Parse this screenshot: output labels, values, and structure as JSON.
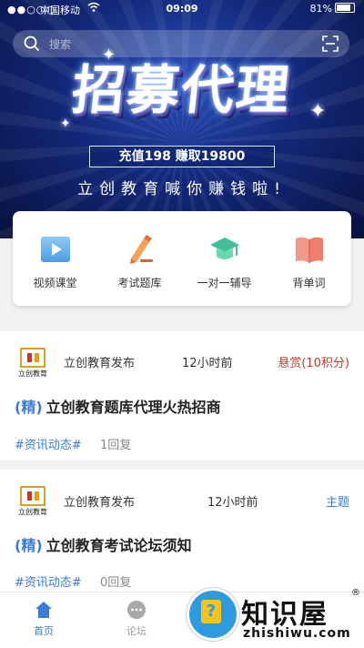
{
  "status_bar": {
    "signal": "●●○○○",
    "carrier": "中国移动",
    "time": "09:09",
    "battery": "81%"
  },
  "search": {
    "placeholder": "搜索"
  },
  "banner": {
    "headline": "招募代理",
    "promo": "充值198  赚取19800",
    "tagline": "立创教育喊你赚钱啦!",
    "slide_count": 5,
    "active_slide": 0
  },
  "quick_actions": [
    {
      "label": "视频课堂",
      "icon": "video-play-icon"
    },
    {
      "label": "考试题库",
      "icon": "exam-pen-icon"
    },
    {
      "label": "一对一辅导",
      "icon": "graduation-cap-icon"
    },
    {
      "label": "背单词",
      "icon": "book-icon"
    }
  ],
  "posts": [
    {
      "author": "立创教育发布",
      "time": "12小时前",
      "badge": "悬赏(10积分)",
      "badge_color": "#c0392b",
      "jing": "(精)",
      "title": "立创教育题库代理火热招商",
      "tag": "#资讯动态#",
      "replies": "1回复",
      "logo_text": "立创教育"
    },
    {
      "author": "立创教育发布",
      "time": "12小时前",
      "badge": "主题",
      "badge_color": "#3b7bd6",
      "jing": "(精)",
      "title": "立创教育考试论坛须知",
      "tag": "#资讯动态#",
      "replies": "0回复",
      "logo_text": "立创教育"
    }
  ],
  "bottom_nav": [
    {
      "label": "首页",
      "icon": "home-icon",
      "active": true
    },
    {
      "label": "论坛",
      "icon": "chat-bubble-icon",
      "active": false
    }
  ],
  "watermark": {
    "title": "知识屋",
    "reg": "®",
    "url": "zhishiwu.com"
  },
  "colors": {
    "accent": "#3b7bd6",
    "reward": "#c0392b"
  }
}
